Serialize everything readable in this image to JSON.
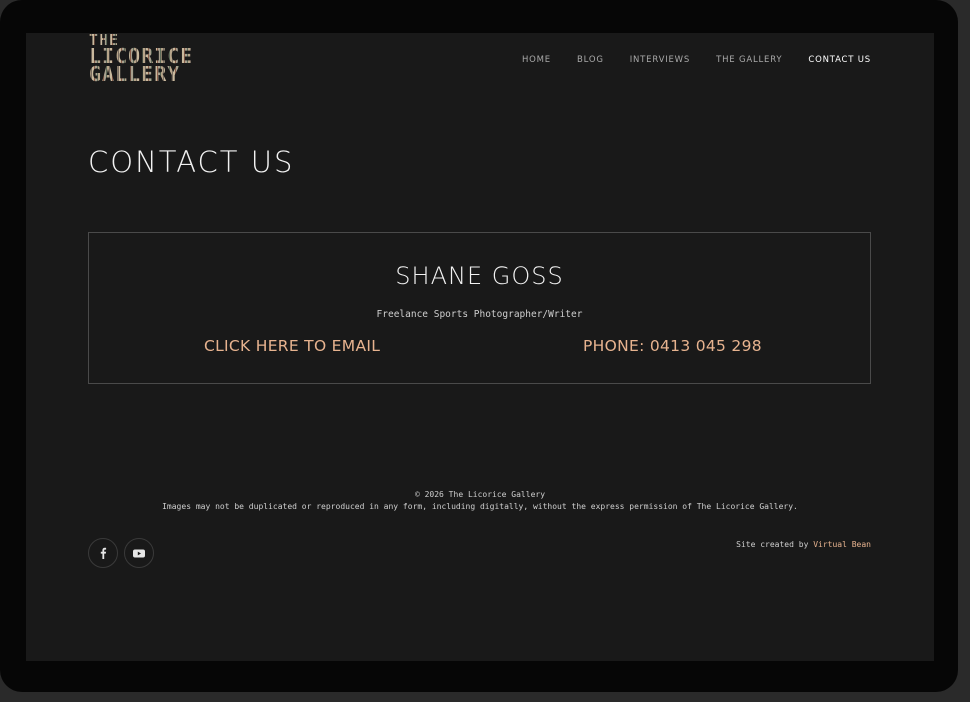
{
  "logo": {
    "line1": "THE",
    "line2": "LICORICE",
    "line3": "GALLERY"
  },
  "nav": {
    "items": [
      {
        "label": "HOME"
      },
      {
        "label": "BLOG"
      },
      {
        "label": "INTERVIEWS"
      },
      {
        "label": "THE GALLERY"
      },
      {
        "label": "CONTACT US"
      }
    ]
  },
  "page": {
    "title": "CONTACT US"
  },
  "contact": {
    "name": "SHANE GOSS",
    "role": "Freelance Sports Photographer/Writer",
    "email_label": "CLICK HERE TO EMAIL",
    "phone_label": "PHONE: 0413 045 298"
  },
  "footer": {
    "copyright": "© 2026 The Licorice Gallery",
    "notice": "Images may not be duplicated or reproduced in any form, including digitally, without the express permission of The Licorice Gallery.",
    "credit_prefix": "Site created by ",
    "credit_link": "Virtual Bean",
    "social": [
      {
        "icon": "facebook-icon"
      },
      {
        "icon": "youtube-icon"
      }
    ]
  },
  "colors": {
    "background": "#191919",
    "accent": "#e7b38f",
    "text": "#f2f2f2",
    "frame": "#060606"
  }
}
